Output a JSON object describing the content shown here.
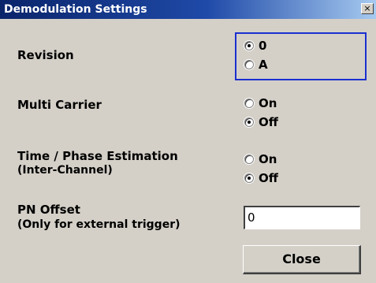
{
  "window": {
    "title": "Demodulation Settings",
    "close_glyph": "×"
  },
  "revision": {
    "label": "Revision",
    "options": [
      {
        "label": "0",
        "checked": true
      },
      {
        "label": "A",
        "checked": false
      }
    ]
  },
  "multi_carrier": {
    "label": "Multi Carrier",
    "options": [
      {
        "label": "On",
        "checked": false
      },
      {
        "label": "Off",
        "checked": true
      }
    ]
  },
  "time_phase": {
    "label": "Time / Phase Estimation",
    "sublabel": "(Inter-Channel)",
    "options": [
      {
        "label": "On",
        "checked": false
      },
      {
        "label": "Off",
        "checked": true
      }
    ]
  },
  "pn_offset": {
    "label": "PN Offset",
    "sublabel": "(Only for external trigger)",
    "value": "0"
  },
  "buttons": {
    "close_label": "Close"
  },
  "colors": {
    "title_bar": "#0a246a",
    "focus_border": "#1a2fd0",
    "dialog_bg": "#d4d0c8"
  }
}
